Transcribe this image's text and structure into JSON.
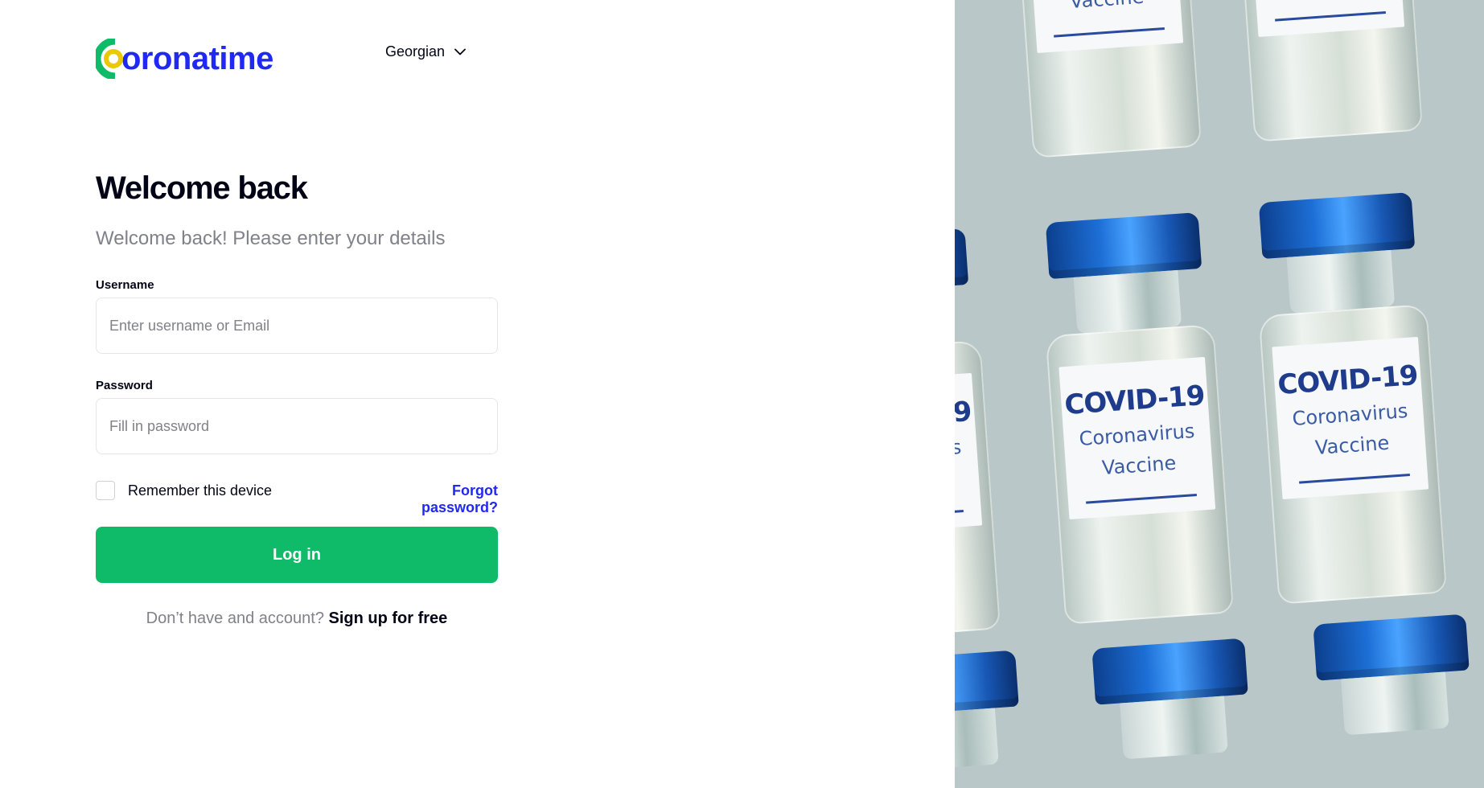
{
  "brand": {
    "name": "oronatime",
    "colors": {
      "primary": "#2029f3",
      "green": "#0fba68",
      "yellow": "#eac903",
      "text": "#010414",
      "muted": "#808189"
    }
  },
  "language_selector": {
    "value": "Georgian",
    "icon": "chevron-down-icon"
  },
  "heading": {
    "title": "Welcome back",
    "subtitle": "Welcome back! Please enter your details"
  },
  "form": {
    "username": {
      "label": "Username",
      "placeholder": "Enter username or Email",
      "value": ""
    },
    "password": {
      "label": "Password",
      "placeholder": "Fill in password",
      "value": ""
    },
    "remember_label": "Remember this device",
    "remember_checked": false,
    "forgot_label": "Forgot password?",
    "submit_label": "Log in"
  },
  "signup": {
    "prompt": "Don’t have and account?",
    "link_label": "Sign up for free"
  },
  "hero_image": {
    "vial_label_line1": "COVID-19",
    "vial_label_line2": "Coronavirus",
    "vial_label_line3": "Vaccine"
  }
}
